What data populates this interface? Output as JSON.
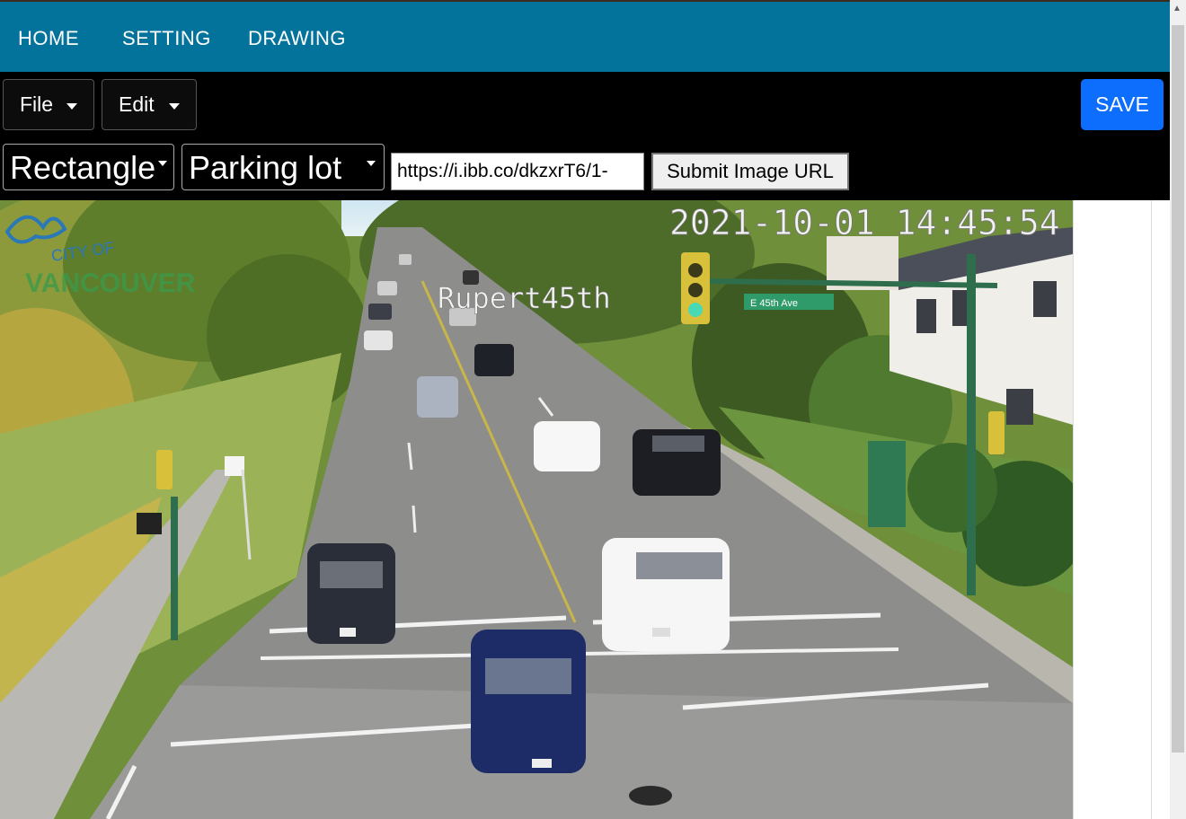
{
  "nav": {
    "items": [
      {
        "label": "HOME"
      },
      {
        "label": "SETTING"
      },
      {
        "label": "DRAWING"
      }
    ]
  },
  "toolbar": {
    "file_label": "File",
    "edit_label": "Edit",
    "save_label": "SAVE",
    "shape_select": "Rectangle",
    "category_select": "Parking lot",
    "url_value": "https://i.ibb.co/dkzxrT6/1-",
    "submit_label": "Submit Image URL"
  },
  "camera": {
    "timestamp": "2021-10-01 14:45:54",
    "location_label": "Rupert45th",
    "logo_line1": "CITY OF",
    "logo_line2": "VANCOUVER",
    "street_sign": "E 45th Ave"
  },
  "colors": {
    "navbar": "#03739c",
    "toolbar": "#000000",
    "save_button": "#0d6efd"
  }
}
